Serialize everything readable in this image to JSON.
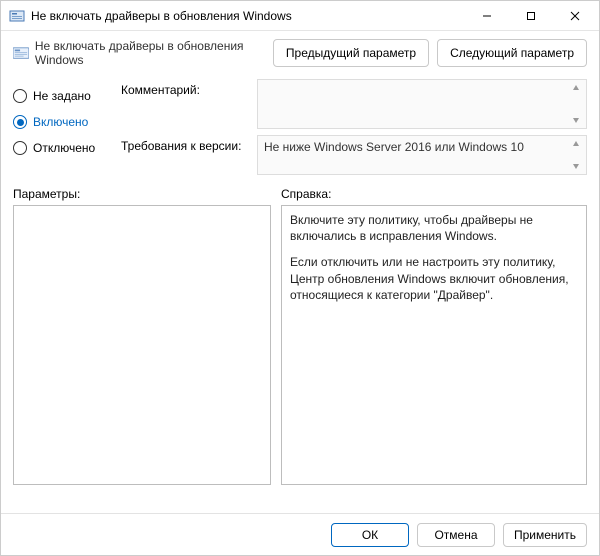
{
  "titlebar": {
    "title": "Не включать драйверы в обновления Windows"
  },
  "header": {
    "subtitle": "Не включать драйверы в обновления Windows",
    "prev": "Предыдущий параметр",
    "next": "Следующий параметр"
  },
  "state": {
    "not_configured": "Не задано",
    "enabled": "Включено",
    "disabled": "Отключено",
    "selected": "enabled"
  },
  "fields": {
    "comment_label": "Комментарий:",
    "comment_value": "",
    "supported_label": "Требования к версии:",
    "supported_value": "Не ниже Windows Server 2016 или Windows 10"
  },
  "columns": {
    "options": "Параметры:",
    "help": "Справка:"
  },
  "help": {
    "p1": "Включите эту политику, чтобы драйверы не включались в исправления Windows.",
    "p2": "Если отключить или не настроить эту политику, Центр обновления Windows включит обновления, относящиеся к категории \"Драйвер\"."
  },
  "footer": {
    "ok": "ОК",
    "cancel": "Отмена",
    "apply": "Применить"
  }
}
